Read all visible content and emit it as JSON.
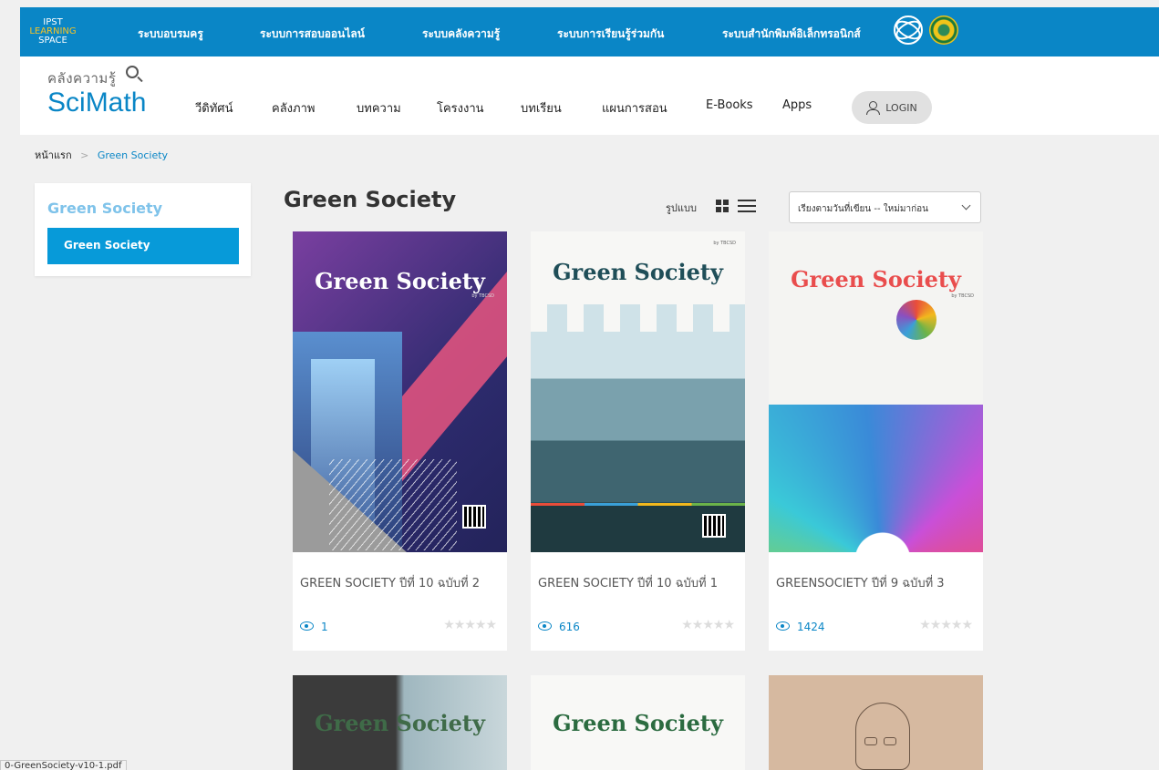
{
  "topbar": {
    "logo": {
      "line1": "IPST",
      "line2": "LEARNING",
      "line3": "SPACE"
    },
    "links": [
      "ระบบอบรมครู",
      "ระบบการสอบออนไลน์",
      "ระบบคลังความรู้",
      "ระบบการเรียนรู้ร่วมกัน",
      "ระบบสำนักพิมพ์อิเล็กทรอนิกส์"
    ],
    "color": "#0a86c6"
  },
  "header": {
    "logo": {
      "thai": "คลังความรู้",
      "sci": "Sci",
      "math": "Math"
    },
    "nav": [
      "วีดิทัศน์",
      "คลังภาพ",
      "บทความ",
      "โครงงาน",
      "บทเรียน",
      "แผนการสอน",
      "E-Books",
      "Apps"
    ],
    "login_label": "LOGIN"
  },
  "breadcrumb": {
    "home": "หน้าแรก",
    "sep": ">",
    "current": "Green Society"
  },
  "sidebar": {
    "title": "Green Society",
    "items": [
      "Green Society"
    ]
  },
  "main": {
    "title": "Green Society",
    "view_label": "รูปแบบ",
    "sort_value": "เรียงตามวันที่เขียน -- ใหม่มาก่อน"
  },
  "cards": [
    {
      "cover_title": "Green Society",
      "title": "GREEN SOCIETY ปีที่ 10 ฉบับที่ 2",
      "views": "1"
    },
    {
      "cover_title": "Green Society",
      "title": "GREEN SOCIETY ปีที่ 10 ฉบับที่ 1",
      "views": "616"
    },
    {
      "cover_title": "Green Society",
      "title": "GREENSOCIETY ปีที่ 9 ฉบับที่ 3",
      "views": "1424"
    },
    {
      "cover_title": "Green Society"
    },
    {
      "cover_title": "Green Society"
    },
    {
      "cover_title": ""
    }
  ],
  "cover_tag": "by TBCSD",
  "stars": "★★★★★",
  "statusbar": "0-GreenSociety-v10-1.pdf"
}
